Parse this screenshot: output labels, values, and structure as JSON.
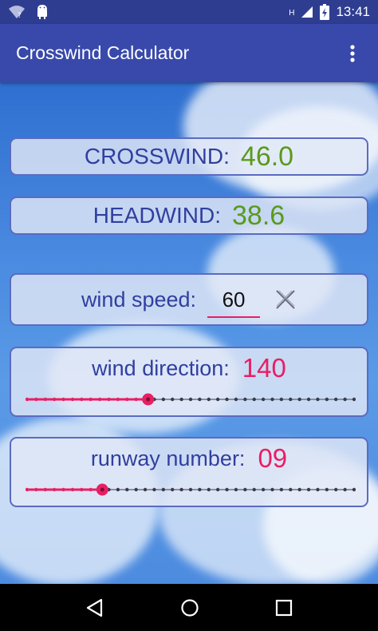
{
  "status_bar": {
    "time": "13:41",
    "network_indicator": "H"
  },
  "app_bar": {
    "title": "Crosswind Calculator",
    "overflow_icon": "more-vert-icon"
  },
  "results": {
    "crosswind_label": "CROSSWIND:",
    "crosswind_value": "46.0",
    "headwind_label": "HEADWIND:",
    "headwind_value": "38.6"
  },
  "wind_speed": {
    "label": "wind speed:",
    "value": "60",
    "clear_icon": "close-icon"
  },
  "wind_direction": {
    "label": "wind direction:",
    "value": "140",
    "slider_fraction": 0.37,
    "tick_count": 36
  },
  "runway_number": {
    "label": "runway number:",
    "value": "09",
    "slider_fraction": 0.23,
    "tick_count": 36
  },
  "colors": {
    "primary": "#3949ab",
    "primary_dark": "#2f3d91",
    "accent": "#e91e63",
    "result_green": "#5a9a1a",
    "label_blue": "#303f9f"
  },
  "nav_bar": {
    "back_icon": "back-triangle-icon",
    "home_icon": "home-circle-icon",
    "recents_icon": "recents-square-icon"
  }
}
